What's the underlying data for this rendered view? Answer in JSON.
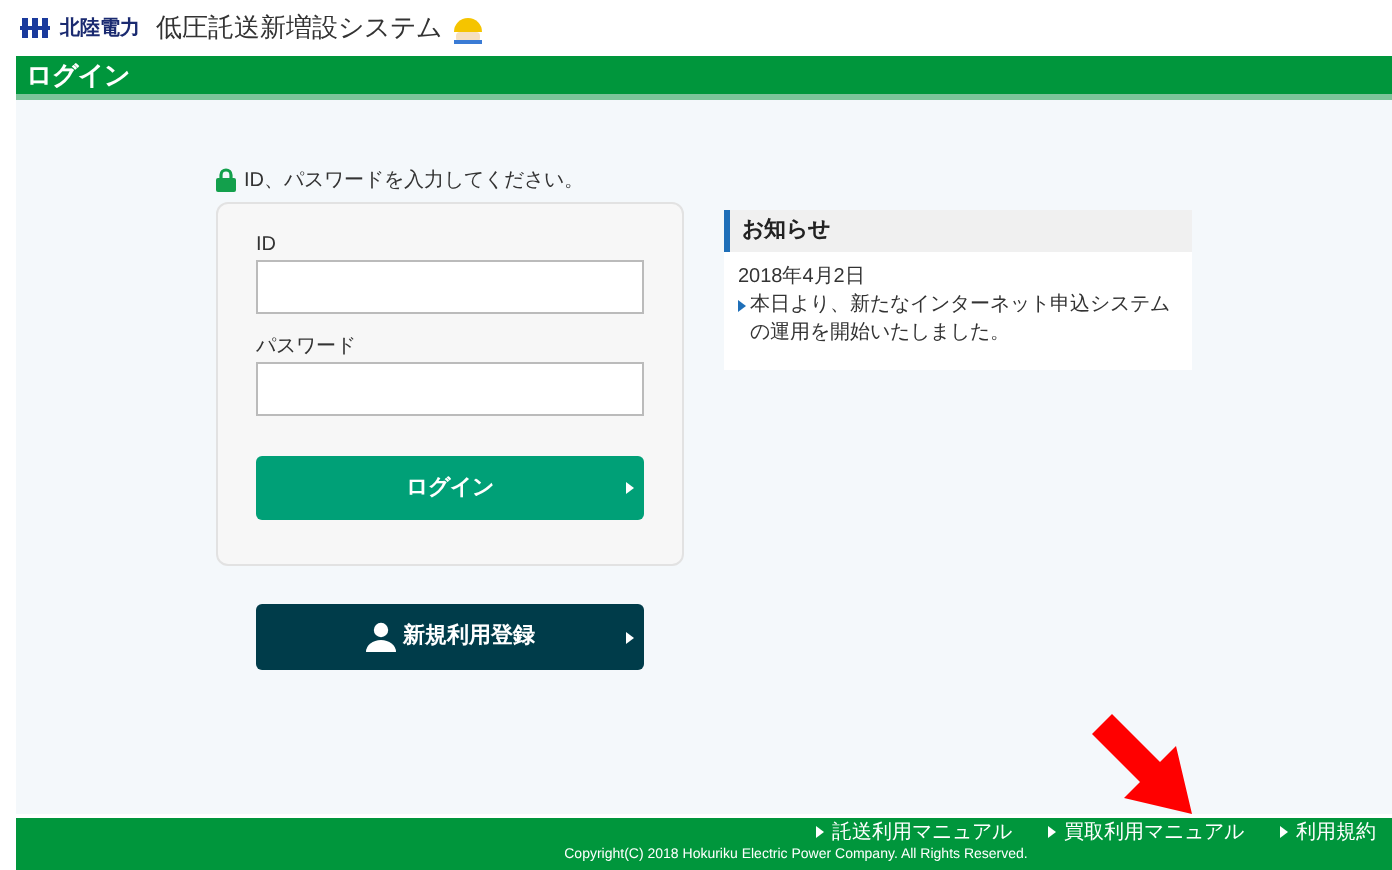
{
  "header": {
    "company": "北陸電力",
    "system_title": "低圧託送新増設システム"
  },
  "page_title": "ログイン",
  "instruction": "ID、パスワードを入力してください。",
  "form": {
    "fields": [
      {
        "label": "ID"
      },
      {
        "label": "パスワード"
      }
    ],
    "login_button": "ログイン"
  },
  "register_button": "新規利用登録",
  "news": {
    "title": "お知らせ",
    "items": [
      {
        "date": "2018年4月2日",
        "text": "本日より、新たなインターネット申込システムの運用を開始いたしました。"
      }
    ]
  },
  "footer": {
    "links": [
      "託送利用マニュアル",
      "買取利用マニュアル",
      "利用規約"
    ],
    "copyright": "Copyright(C) 2018 Hokuriku Electric Power Company. All Rights Reserved."
  }
}
